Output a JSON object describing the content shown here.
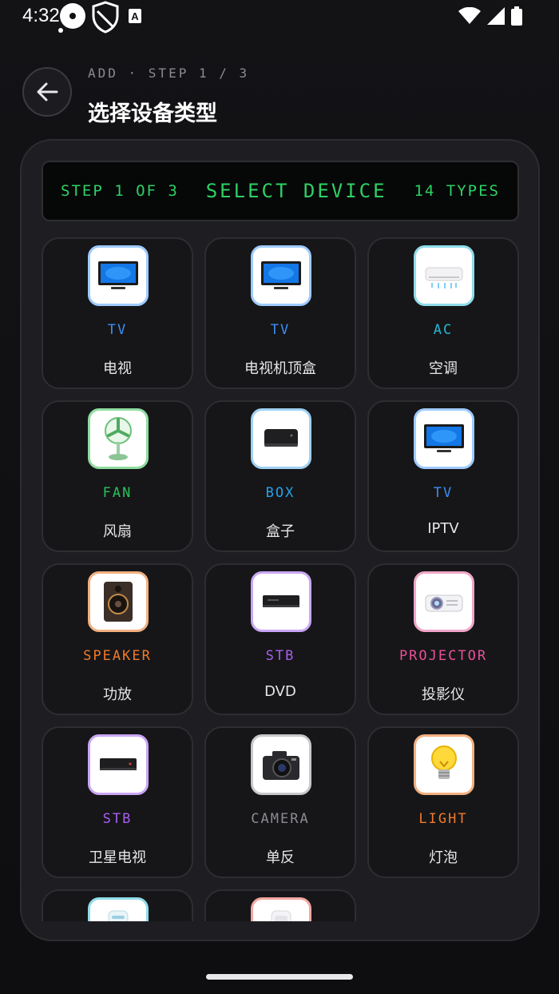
{
  "status_bar": {
    "time": "4:32"
  },
  "header": {
    "step_label": "ADD · STEP 1 / 3",
    "title": "选择设备类型"
  },
  "lcd": {
    "left": "STEP 1 OF 3",
    "center": "SELECT DEVICE",
    "right": "14 TYPES"
  },
  "devices": [
    {
      "code": "TV",
      "name": "电视",
      "icon": "tv-icon",
      "code_color": "#3b8df5",
      "tile_border": "#9fcbff"
    },
    {
      "code": "TV",
      "name": "电视机顶盒",
      "icon": "tv-icon",
      "code_color": "#3b8df5",
      "tile_border": "#9fcbff"
    },
    {
      "code": "AC",
      "name": "空调",
      "icon": "air-conditioner-icon",
      "code_color": "#27b7d6",
      "tile_border": "#8fdcea"
    },
    {
      "code": "FAN",
      "name": "风扇",
      "icon": "fan-icon",
      "code_color": "#27c15a",
      "tile_border": "#8fdca0"
    },
    {
      "code": "BOX",
      "name": "盒子",
      "icon": "set-top-box-icon",
      "code_color": "#2aa0e8",
      "tile_border": "#9fd0f2"
    },
    {
      "code": "TV",
      "name": "IPTV",
      "icon": "tv-icon",
      "code_color": "#3b8df5",
      "tile_border": "#9fcbff"
    },
    {
      "code": "SPEAKER",
      "name": "功放",
      "icon": "speaker-icon",
      "code_color": "#f07a2a",
      "tile_border": "#f2b080"
    },
    {
      "code": "STB",
      "name": "DVD",
      "icon": "dvd-player-icon",
      "code_color": "#a65ef0",
      "tile_border": "#c9a6f5"
    },
    {
      "code": "PROJECTOR",
      "name": "投影仪",
      "icon": "projector-icon",
      "code_color": "#e8509a",
      "tile_border": "#f0a6c8"
    },
    {
      "code": "STB",
      "name": "卫星电视",
      "icon": "satellite-receiver-icon",
      "code_color": "#a65ef0",
      "tile_border": "#c9a6f5"
    },
    {
      "code": "CAMERA",
      "name": "单反",
      "icon": "camera-icon",
      "code_color": "#8a8a92",
      "tile_border": "#c8c8cc"
    },
    {
      "code": "LIGHT",
      "name": "灯泡",
      "icon": "light-bulb-icon",
      "code_color": "#f07a2a",
      "tile_border": "#f2b080"
    },
    {
      "code": "",
      "name": "",
      "icon": "water-heater-icon",
      "code_color": "#27b7d6",
      "tile_border": "#8fdcea"
    },
    {
      "code": "",
      "name": "",
      "icon": "purifier-icon",
      "code_color": "#e85050",
      "tile_border": "#f2a6a0"
    }
  ]
}
